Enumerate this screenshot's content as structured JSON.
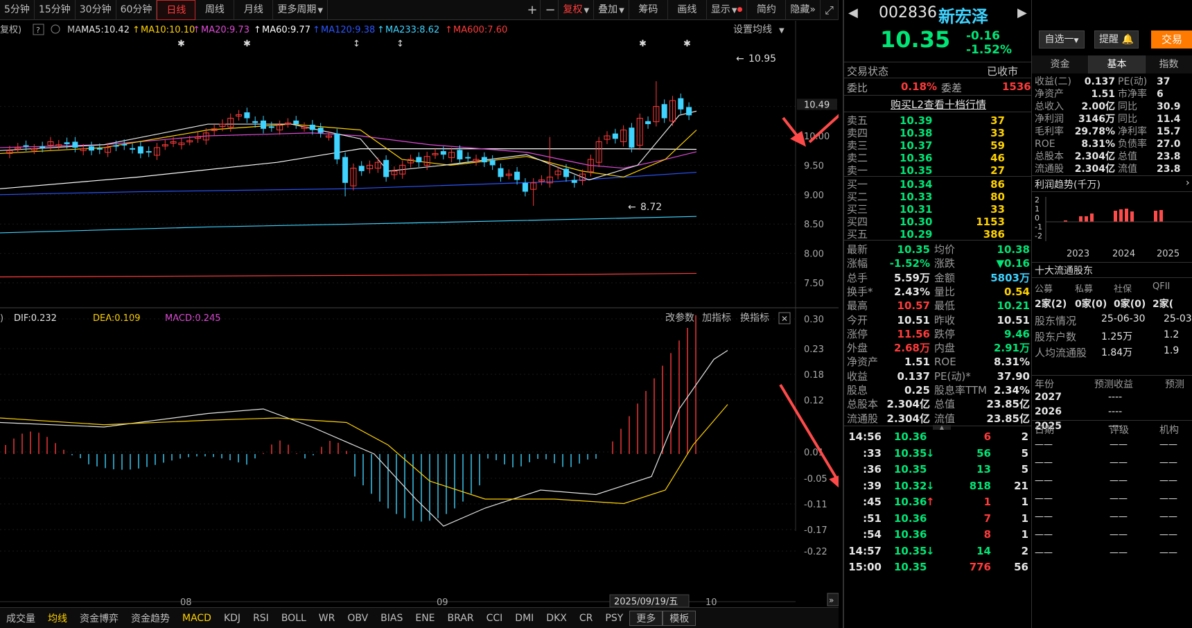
{
  "toolbar": {
    "periods": [
      "5分钟",
      "15分钟",
      "30分钟",
      "60分钟",
      "日线",
      "周线",
      "月线",
      "更多周期"
    ],
    "active_period": "日线",
    "tools": [
      "复权",
      "叠加",
      "筹码",
      "画线",
      "显示",
      "简约",
      "隐藏"
    ],
    "plus": "+",
    "minus": "−",
    "expand": "⤢",
    "more_arrows": "»"
  },
  "ma_legend": {
    "prefix": "复权)",
    "help": "?",
    "label": "MA",
    "items": [
      {
        "text": "MA5:10.42",
        "color": "#e6e6e6"
      },
      {
        "text": "MA10:10.10",
        "color": "#ffd200"
      },
      {
        "text": "MA20:9.73",
        "color": "#e04bd8"
      },
      {
        "text": "MA60:9.77",
        "color": "#ffffff"
      },
      {
        "text": "MA120:9.38",
        "color": "#2b55ff"
      },
      {
        "text": "MA233:8.62",
        "color": "#3fd3ff"
      },
      {
        "text": "MA600:7.60",
        "color": "#ff3b3b"
      }
    ],
    "setting": "设置均线"
  },
  "price_axis": {
    "ticks": [
      "10.49",
      "10.50",
      "10.00",
      "9.50",
      "9.00",
      "8.50",
      "8.00",
      "7.50"
    ],
    "current": "10.49"
  },
  "annotations": {
    "high": "10.95",
    "low": "8.72"
  },
  "macd_legend": {
    "items": [
      {
        "text": "DIF:0.232",
        "color": "#e6e6e6"
      },
      {
        "text": "DEA:0.109",
        "color": "#ffd200"
      },
      {
        "text": "MACD:0.245",
        "color": "#e04bd8"
      }
    ],
    "buttons": [
      "改参数",
      "加指标",
      "换指标"
    ],
    "close": "✕"
  },
  "macd_axis": {
    "ticks": [
      "0.30",
      "0.23",
      "0.18",
      "0.12",
      "0.01",
      "-0.05",
      "-0.11",
      "-0.17",
      "-0.22"
    ]
  },
  "time_axis": {
    "labels": [
      "08",
      "09",
      "10"
    ],
    "cursor_date": "2025/09/19/五"
  },
  "bottom_tabs": [
    "成交量",
    "均线",
    "资金博弈",
    "资金趋势",
    "MACD",
    "KDJ",
    "RSI",
    "BOLL",
    "WR",
    "OBV",
    "BIAS",
    "ENE",
    "BRAR",
    "CCI",
    "DMI",
    "DKX",
    "CR",
    "PSY"
  ],
  "bottom_active": [
    "均线",
    "MACD"
  ],
  "bottom_more": "更多",
  "bottom_template": "模板",
  "quote": {
    "code": "002836",
    "name": "新宏泽",
    "price": "10.35",
    "change": "-0.16",
    "pct": "-1.52%",
    "status_label": "交易状态",
    "status": "已收市",
    "wb_label": "委比",
    "wb_value": "0.18%",
    "wc_label": "委差",
    "wc_value": "1536",
    "l2": "购买L2查看十档行情",
    "asks": [
      {
        "label": "卖五",
        "price": "10.39",
        "vol": "37"
      },
      {
        "label": "卖四",
        "price": "10.38",
        "vol": "33"
      },
      {
        "label": "卖三",
        "price": "10.37",
        "vol": "59"
      },
      {
        "label": "卖二",
        "price": "10.36",
        "vol": "46"
      },
      {
        "label": "卖一",
        "price": "10.35",
        "vol": "27"
      }
    ],
    "bids": [
      {
        "label": "买一",
        "price": "10.34",
        "vol": "86"
      },
      {
        "label": "买二",
        "price": "10.33",
        "vol": "80"
      },
      {
        "label": "买三",
        "price": "10.31",
        "vol": "33"
      },
      {
        "label": "买四",
        "price": "10.30",
        "vol": "1153"
      },
      {
        "label": "买五",
        "price": "10.29",
        "vol": "386"
      }
    ],
    "stats": [
      [
        {
          "l": "最新",
          "v": "10.35",
          "c": "grn"
        },
        {
          "l": "均价",
          "v": "10.38",
          "c": "grn"
        }
      ],
      [
        {
          "l": "涨幅",
          "v": "-1.52%",
          "c": "grn"
        },
        {
          "l": "涨跌",
          "v": "▼0.16",
          "c": "grn"
        }
      ],
      [
        {
          "l": "总手",
          "v": "5.59万",
          "c": "wh"
        },
        {
          "l": "金额",
          "v": "5803万",
          "c": "cy"
        }
      ],
      [
        {
          "l": "换手*",
          "v": "2.43%",
          "c": "wh"
        },
        {
          "l": "量比",
          "v": "0.54",
          "c": "yel"
        }
      ],
      [
        {
          "l": "最高",
          "v": "10.57",
          "c": "red"
        },
        {
          "l": "最低",
          "v": "10.21",
          "c": "grn"
        }
      ],
      [
        {
          "l": "今开",
          "v": "10.51",
          "c": "wh"
        },
        {
          "l": "昨收",
          "v": "10.51",
          "c": "wh"
        }
      ],
      [
        {
          "l": "涨停",
          "v": "11.56",
          "c": "red"
        },
        {
          "l": "跌停",
          "v": "9.46",
          "c": "grn"
        }
      ],
      [
        {
          "l": "外盘",
          "v": "2.68万",
          "c": "red"
        },
        {
          "l": "内盘",
          "v": "2.91万",
          "c": "grn"
        }
      ],
      [
        {
          "l": "净资产",
          "v": "1.51",
          "c": "wh"
        },
        {
          "l": "ROE",
          "v": "8.31%",
          "c": "wh"
        }
      ],
      [
        {
          "l": "收益",
          "v": "0.137",
          "c": "wh"
        },
        {
          "l": "PE(动)*",
          "v": "37.90",
          "c": "wh"
        }
      ],
      [
        {
          "l": "股息",
          "v": "0.25",
          "c": "wh"
        },
        {
          "l": "股息率TTM",
          "v": "2.34%",
          "c": "wh"
        }
      ],
      [
        {
          "l": "总股本",
          "v": "2.304亿",
          "c": "wh"
        },
        {
          "l": "总值",
          "v": "23.85亿",
          "c": "wh"
        }
      ],
      [
        {
          "l": "流通股",
          "v": "2.304亿",
          "c": "wh"
        },
        {
          "l": "流值",
          "v": "23.85亿",
          "c": "wh"
        }
      ]
    ],
    "ticks": [
      {
        "t": "14:56",
        "p": "10.36",
        "arr": "",
        "v": "6",
        "n": "2",
        "vc": "red"
      },
      {
        "t": ":33",
        "p": "10.35",
        "arr": "↓",
        "v": "56",
        "n": "5",
        "vc": "grn"
      },
      {
        "t": ":36",
        "p": "10.35",
        "arr": "",
        "v": "13",
        "n": "5",
        "vc": "grn"
      },
      {
        "t": ":39",
        "p": "10.32",
        "arr": "↓",
        "v": "818",
        "n": "21",
        "vc": "grn"
      },
      {
        "t": ":45",
        "p": "10.36",
        "arr": "↑",
        "v": "1",
        "n": "1",
        "vc": "red"
      },
      {
        "t": ":51",
        "p": "10.36",
        "arr": "",
        "v": "7",
        "n": "1",
        "vc": "red"
      },
      {
        "t": ":54",
        "p": "10.36",
        "arr": "",
        "v": "8",
        "n": "1",
        "vc": "red"
      },
      {
        "t": "14:57",
        "p": "10.35",
        "arr": "↓",
        "v": "14",
        "n": "2",
        "vc": "grn"
      },
      {
        "t": "15:00",
        "p": "10.35",
        "arr": "",
        "v": "776",
        "n": "56",
        "vc": "red"
      }
    ]
  },
  "info": {
    "buttons": {
      "watch": "自选一",
      "alert": "提醒",
      "trade": "交易"
    },
    "tabs": [
      "资金",
      "基本",
      "指数"
    ],
    "active_tab": "基本",
    "fund": [
      [
        {
          "l": "收益(二)",
          "v": "0.137"
        },
        {
          "l": "PE(动)",
          "v": "37"
        }
      ],
      [
        {
          "l": "净资产",
          "v": "1.51"
        },
        {
          "l": "市净率",
          "v": "6"
        }
      ],
      [
        {
          "l": "总收入",
          "v": "2.00亿"
        },
        {
          "l": "同比",
          "v": "30.9"
        }
      ],
      [
        {
          "l": "净利润",
          "v": "3146万"
        },
        {
          "l": "同比",
          "v": "11.4"
        }
      ],
      [
        {
          "l": "毛利率",
          "v": "29.78%"
        },
        {
          "l": "净利率",
          "v": "15.7"
        }
      ],
      [
        {
          "l": "ROE",
          "v": "8.31%"
        },
        {
          "l": "负债率",
          "v": "27.0"
        }
      ],
      [
        {
          "l": "总股本",
          "v": "2.304亿"
        },
        {
          "l": "总值",
          "v": "23.8"
        }
      ],
      [
        {
          "l": "流通股",
          "v": "2.304亿"
        },
        {
          "l": "流值",
          "v": "23.8"
        }
      ]
    ],
    "profit_title": "利润趋势(千万)",
    "profit_more": "›",
    "profit_axis": [
      "2",
      "1",
      "0",
      "-1",
      "-2"
    ],
    "profit_years": [
      "2023",
      "2024",
      "2025"
    ],
    "chart_data": {
      "type": "bar",
      "title": "利润趋势(千万)",
      "categories": [
        "2023Q1",
        "2023Q2",
        "2023Q3",
        "2023Q4",
        "2024Q1",
        "2024Q2",
        "2024Q3",
        "2024Q4",
        "2025Q1",
        "2025Q2"
      ],
      "values": [
        0.2,
        0.8,
        0.8,
        1.2,
        1.6,
        1.8,
        1.9,
        1.5,
        1.6,
        1.7
      ],
      "ylim": [
        -2,
        2
      ]
    },
    "holders_title": "十大流通股东",
    "holders_cols": [
      "公募",
      "私募",
      "社保",
      "QFII"
    ],
    "holders_vals": [
      "2家(2)",
      "0家(0)",
      "0家(0)",
      "2家("
    ],
    "holders_rows": [
      {
        "l": "股东情况",
        "a": "25-06-30",
        "b": "25-03"
      },
      {
        "l": "股东户数",
        "a": "1.25万",
        "b": "1.2"
      },
      {
        "l": "人均流通股",
        "a": "1.84万",
        "b": "1.9"
      }
    ],
    "forecast_cols": [
      "年份",
      "预测收益",
      "预测"
    ],
    "forecast_rows": [
      {
        "y": "2027",
        "v": "----"
      },
      {
        "y": "2026",
        "v": "----"
      },
      {
        "y": "2025",
        "v": "----"
      }
    ],
    "rating_cols": [
      "日期",
      "评级",
      "机构"
    ],
    "rating_dashes": [
      "——",
      "——",
      "——"
    ]
  }
}
